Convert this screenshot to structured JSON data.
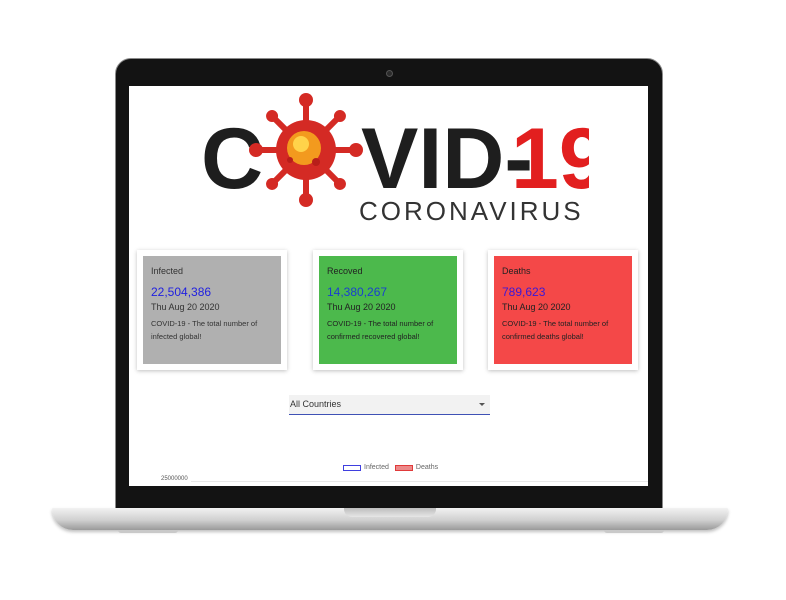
{
  "logo": {
    "word_left": "C",
    "word_right": "VID-",
    "number": "19",
    "tagline": "CORONAVIRUS"
  },
  "cards": [
    {
      "title": "Infected",
      "count": "22,504,386",
      "date": "Thu Aug 20 2020",
      "desc": "COVID-19 - The total number of infected global!",
      "bg": "#b0b0b0",
      "count_color": "#2020e0",
      "text_color": "#333333"
    },
    {
      "title": "Recoved",
      "count": "14,380,267",
      "date": "Thu Aug 20 2020",
      "desc": "COVID-19 - The total number of confirmed recovered global!",
      "bg": "#4cb94c",
      "count_color": "#1a3fcf",
      "text_color": "#222222"
    },
    {
      "title": "Deaths",
      "count": "789,623",
      "date": "Thu Aug 20 2020",
      "desc": "COVID-19 - The total number of confirmed deaths global!",
      "bg": "#f44848",
      "count_color": "#3a18d8",
      "text_color": "#222222"
    }
  ],
  "country_select": {
    "value": "All Countries"
  },
  "chart": {
    "legend": [
      {
        "label": "Infected",
        "color": "#3f3fdf"
      },
      {
        "label": "Deaths",
        "color": "#e03a3a"
      }
    ],
    "ytick_top": "25000000"
  }
}
